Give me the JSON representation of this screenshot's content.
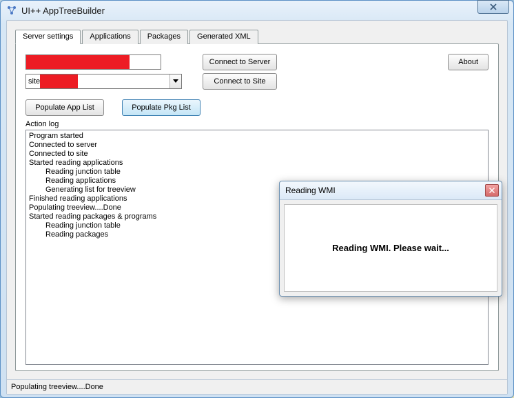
{
  "window": {
    "title": "UI++ AppTreeBuilder"
  },
  "tabs": {
    "server_settings": "Server settings",
    "applications": "Applications",
    "packages": "Packages",
    "generated_xml": "Generated XML"
  },
  "form": {
    "server_value": "",
    "site_value": "site",
    "connect_server": "Connect to Server",
    "connect_site": "Connect to Site",
    "about": "About",
    "populate_app": "Populate App List",
    "populate_pkg": "Populate Pkg List"
  },
  "log": {
    "label": "Action log",
    "lines": [
      {
        "t": "Program started",
        "i": false
      },
      {
        "t": "Connected to server",
        "i": false
      },
      {
        "t": "Connected to site",
        "i": false
      },
      {
        "t": "Started reading applications",
        "i": false
      },
      {
        "t": "Reading junction table",
        "i": true
      },
      {
        "t": "Reading applications",
        "i": true
      },
      {
        "t": "Generating list for treeview",
        "i": true
      },
      {
        "t": "Finished reading applications",
        "i": false
      },
      {
        "t": "Populating treeview....Done",
        "i": false
      },
      {
        "t": "Started reading packages & programs",
        "i": false
      },
      {
        "t": "Reading junction table",
        "i": true
      },
      {
        "t": "Reading packages",
        "i": true
      }
    ]
  },
  "statusbar": {
    "text": "Populating treeview....Done"
  },
  "dialog": {
    "title": "Reading WMI",
    "body": "Reading WMI. Please wait..."
  }
}
